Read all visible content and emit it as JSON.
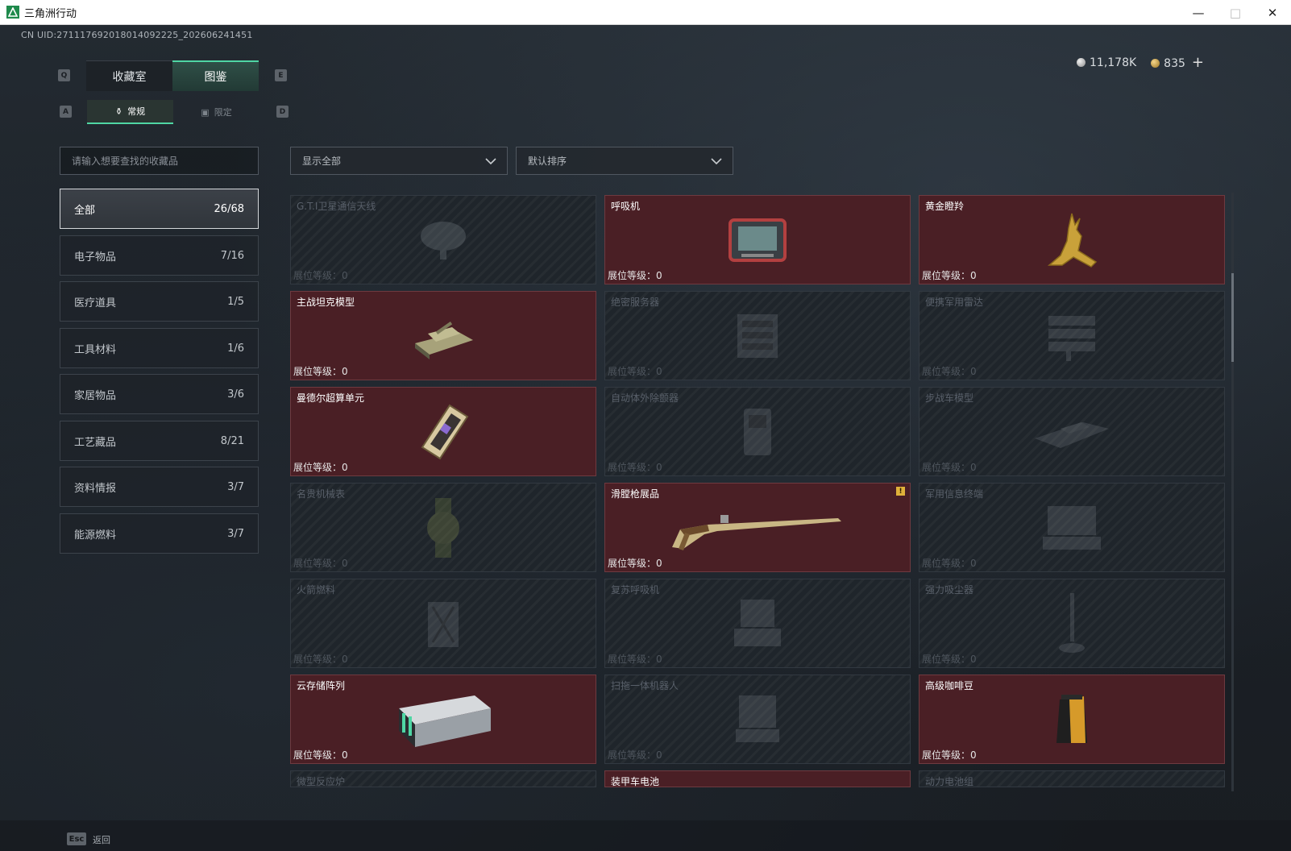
{
  "window": {
    "title": "三角洲行动",
    "minimize": "—",
    "maximize": "□",
    "close": "✕"
  },
  "uid": "CN UID:271117692018014092225_202606241451",
  "currency": {
    "silver": "11,178K",
    "gold": "835",
    "add": "+"
  },
  "keys": {
    "q": "Q",
    "e": "E",
    "a": "A",
    "d": "D",
    "esc": "Esc"
  },
  "tabs": {
    "collection_room": "收藏室",
    "catalog": "图鉴"
  },
  "subtabs": {
    "regular": "常规",
    "limited": "限定"
  },
  "search": {
    "placeholder": "请输入想要查找的收藏品"
  },
  "filters": {
    "show": "显示全部",
    "sort": "默认排序"
  },
  "categories": [
    {
      "label": "全部",
      "count": "26/68"
    },
    {
      "label": "电子物品",
      "count": "7/16"
    },
    {
      "label": "医疗道具",
      "count": "1/5"
    },
    {
      "label": "工具材料",
      "count": "1/6"
    },
    {
      "label": "家居物品",
      "count": "3/6"
    },
    {
      "label": "工艺藏品",
      "count": "8/21"
    },
    {
      "label": "资料情报",
      "count": "3/7"
    },
    {
      "label": "能源燃料",
      "count": "3/7"
    }
  ],
  "level_label": "展位等级：",
  "items": [
    {
      "name": "G.T.I卫星通信天线",
      "level": "0",
      "owned": false,
      "icon": "satellite-dish-icon"
    },
    {
      "name": "呼吸机",
      "level": "0",
      "owned": true,
      "icon": "ventilator-icon"
    },
    {
      "name": "黄金瞪羚",
      "level": "0",
      "owned": true,
      "icon": "golden-gazelle-icon"
    },
    {
      "name": "主战坦克模型",
      "level": "0",
      "owned": true,
      "icon": "tank-model-icon"
    },
    {
      "name": "绝密服务器",
      "level": "0",
      "owned": false,
      "icon": "server-icon"
    },
    {
      "name": "便携军用雷达",
      "level": "0",
      "owned": false,
      "icon": "radar-icon"
    },
    {
      "name": "曼德尔超算单元",
      "level": "0",
      "owned": true,
      "icon": "supercomputer-unit-icon"
    },
    {
      "name": "自动体外除颤器",
      "level": "0",
      "owned": false,
      "icon": "defibrillator-icon"
    },
    {
      "name": "步战车模型",
      "level": "0",
      "owned": false,
      "icon": "ifv-model-icon"
    },
    {
      "name": "名贵机械表",
      "level": "0",
      "owned": false,
      "icon": "watch-icon"
    },
    {
      "name": "滑膛枪展品",
      "level": "0",
      "owned": true,
      "icon": "musket-icon",
      "alert": "!"
    },
    {
      "name": "军用信息终端",
      "level": "0",
      "owned": false,
      "icon": "terminal-icon"
    },
    {
      "name": "火箭燃料",
      "level": "0",
      "owned": false,
      "icon": "fuel-can-icon"
    },
    {
      "name": "复苏呼吸机",
      "level": "0",
      "owned": false,
      "icon": "resuscitator-icon"
    },
    {
      "name": "强力吸尘器",
      "level": "0",
      "owned": false,
      "icon": "vacuum-icon"
    },
    {
      "name": "云存储阵列",
      "level": "0",
      "owned": true,
      "icon": "storage-array-icon"
    },
    {
      "name": "扫拖一体机器人",
      "level": "0",
      "owned": false,
      "icon": "robot-vacuum-icon"
    },
    {
      "name": "高级咖啡豆",
      "level": "0",
      "owned": true,
      "icon": "coffee-bag-icon"
    },
    {
      "name": "微型反应炉",
      "level": "",
      "owned": false,
      "icon": "reactor-icon"
    },
    {
      "name": "装甲车电池",
      "level": "",
      "owned": true,
      "icon": "battery-icon"
    },
    {
      "name": "动力电池组",
      "level": "",
      "owned": false,
      "icon": "power-pack-icon"
    }
  ],
  "back_label": "返回"
}
